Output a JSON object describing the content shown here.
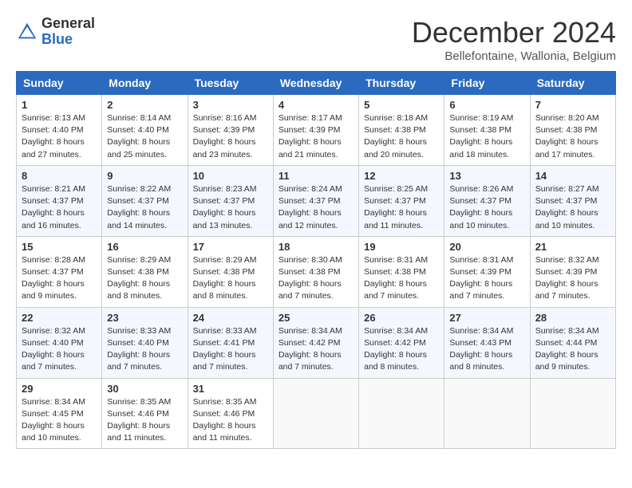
{
  "logo": {
    "general": "General",
    "blue": "Blue"
  },
  "header": {
    "month": "December 2024",
    "location": "Bellefontaine, Wallonia, Belgium"
  },
  "days_of_week": [
    "Sunday",
    "Monday",
    "Tuesday",
    "Wednesday",
    "Thursday",
    "Friday",
    "Saturday"
  ],
  "weeks": [
    [
      {
        "day": 1,
        "info": "Sunrise: 8:13 AM\nSunset: 4:40 PM\nDaylight: 8 hours and 27 minutes."
      },
      {
        "day": 2,
        "info": "Sunrise: 8:14 AM\nSunset: 4:40 PM\nDaylight: 8 hours and 25 minutes."
      },
      {
        "day": 3,
        "info": "Sunrise: 8:16 AM\nSunset: 4:39 PM\nDaylight: 8 hours and 23 minutes."
      },
      {
        "day": 4,
        "info": "Sunrise: 8:17 AM\nSunset: 4:39 PM\nDaylight: 8 hours and 21 minutes."
      },
      {
        "day": 5,
        "info": "Sunrise: 8:18 AM\nSunset: 4:38 PM\nDaylight: 8 hours and 20 minutes."
      },
      {
        "day": 6,
        "info": "Sunrise: 8:19 AM\nSunset: 4:38 PM\nDaylight: 8 hours and 18 minutes."
      },
      {
        "day": 7,
        "info": "Sunrise: 8:20 AM\nSunset: 4:38 PM\nDaylight: 8 hours and 17 minutes."
      }
    ],
    [
      {
        "day": 8,
        "info": "Sunrise: 8:21 AM\nSunset: 4:37 PM\nDaylight: 8 hours and 16 minutes."
      },
      {
        "day": 9,
        "info": "Sunrise: 8:22 AM\nSunset: 4:37 PM\nDaylight: 8 hours and 14 minutes."
      },
      {
        "day": 10,
        "info": "Sunrise: 8:23 AM\nSunset: 4:37 PM\nDaylight: 8 hours and 13 minutes."
      },
      {
        "day": 11,
        "info": "Sunrise: 8:24 AM\nSunset: 4:37 PM\nDaylight: 8 hours and 12 minutes."
      },
      {
        "day": 12,
        "info": "Sunrise: 8:25 AM\nSunset: 4:37 PM\nDaylight: 8 hours and 11 minutes."
      },
      {
        "day": 13,
        "info": "Sunrise: 8:26 AM\nSunset: 4:37 PM\nDaylight: 8 hours and 10 minutes."
      },
      {
        "day": 14,
        "info": "Sunrise: 8:27 AM\nSunset: 4:37 PM\nDaylight: 8 hours and 10 minutes."
      }
    ],
    [
      {
        "day": 15,
        "info": "Sunrise: 8:28 AM\nSunset: 4:37 PM\nDaylight: 8 hours and 9 minutes."
      },
      {
        "day": 16,
        "info": "Sunrise: 8:29 AM\nSunset: 4:38 PM\nDaylight: 8 hours and 8 minutes."
      },
      {
        "day": 17,
        "info": "Sunrise: 8:29 AM\nSunset: 4:38 PM\nDaylight: 8 hours and 8 minutes."
      },
      {
        "day": 18,
        "info": "Sunrise: 8:30 AM\nSunset: 4:38 PM\nDaylight: 8 hours and 7 minutes."
      },
      {
        "day": 19,
        "info": "Sunrise: 8:31 AM\nSunset: 4:38 PM\nDaylight: 8 hours and 7 minutes."
      },
      {
        "day": 20,
        "info": "Sunrise: 8:31 AM\nSunset: 4:39 PM\nDaylight: 8 hours and 7 minutes."
      },
      {
        "day": 21,
        "info": "Sunrise: 8:32 AM\nSunset: 4:39 PM\nDaylight: 8 hours and 7 minutes."
      }
    ],
    [
      {
        "day": 22,
        "info": "Sunrise: 8:32 AM\nSunset: 4:40 PM\nDaylight: 8 hours and 7 minutes."
      },
      {
        "day": 23,
        "info": "Sunrise: 8:33 AM\nSunset: 4:40 PM\nDaylight: 8 hours and 7 minutes."
      },
      {
        "day": 24,
        "info": "Sunrise: 8:33 AM\nSunset: 4:41 PM\nDaylight: 8 hours and 7 minutes."
      },
      {
        "day": 25,
        "info": "Sunrise: 8:34 AM\nSunset: 4:42 PM\nDaylight: 8 hours and 7 minutes."
      },
      {
        "day": 26,
        "info": "Sunrise: 8:34 AM\nSunset: 4:42 PM\nDaylight: 8 hours and 8 minutes."
      },
      {
        "day": 27,
        "info": "Sunrise: 8:34 AM\nSunset: 4:43 PM\nDaylight: 8 hours and 8 minutes."
      },
      {
        "day": 28,
        "info": "Sunrise: 8:34 AM\nSunset: 4:44 PM\nDaylight: 8 hours and 9 minutes."
      }
    ],
    [
      {
        "day": 29,
        "info": "Sunrise: 8:34 AM\nSunset: 4:45 PM\nDaylight: 8 hours and 10 minutes."
      },
      {
        "day": 30,
        "info": "Sunrise: 8:35 AM\nSunset: 4:46 PM\nDaylight: 8 hours and 11 minutes."
      },
      {
        "day": 31,
        "info": "Sunrise: 8:35 AM\nSunset: 4:46 PM\nDaylight: 8 hours and 11 minutes."
      },
      null,
      null,
      null,
      null
    ]
  ]
}
